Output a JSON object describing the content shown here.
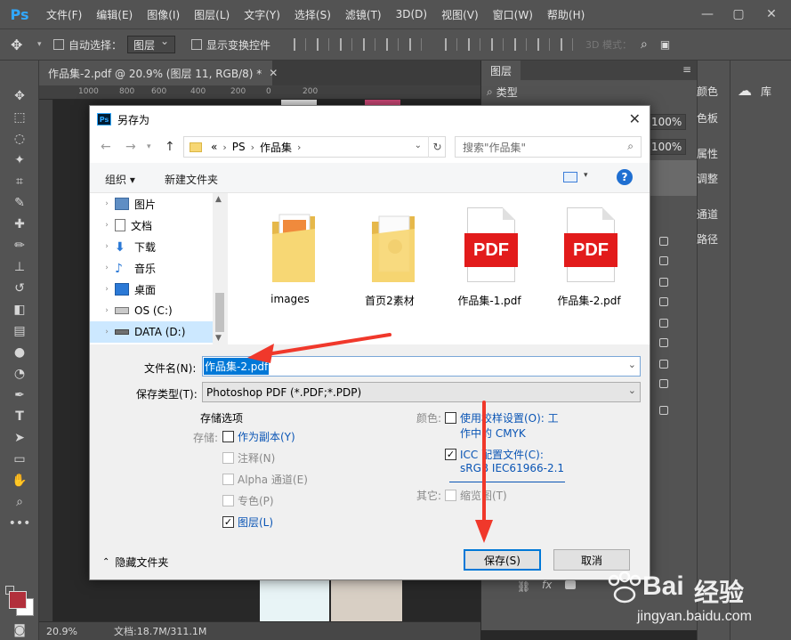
{
  "menubar": {
    "logo": "Ps",
    "items": [
      "文件(F)",
      "编辑(E)",
      "图像(I)",
      "图层(L)",
      "文字(Y)",
      "选择(S)",
      "滤镜(T)",
      "3D(D)",
      "视图(V)",
      "窗口(W)",
      "帮助(H)"
    ]
  },
  "optionsbar": {
    "auto_select_label": "自动选择：",
    "auto_select_value": "图层",
    "show_transform_label": "显示变换控件",
    "mode_3d": "3D 模式："
  },
  "document": {
    "tab_title": "作品集-2.pdf @ 20.9% (图层 11, RGB/8) *",
    "ruler_ticks": [
      "1000",
      "800",
      "600",
      "400",
      "200",
      "0",
      "200"
    ],
    "zoom": "20.9%",
    "doc_size": "文档:18.7M/311.1M"
  },
  "layers_panel": {
    "tab": "图层",
    "kind_label": "类型",
    "opacity": "100%",
    "fill": "100%",
    "footer_icons": [
      "link-icon",
      "fx-icon",
      "mask-icon"
    ]
  },
  "side_panels": {
    "labels": [
      "颜色",
      "色板",
      "属性",
      "调整",
      "通道",
      "路径"
    ],
    "library": "库"
  },
  "dialog": {
    "title": "另存为",
    "breadcrumb": [
      "«",
      "PS",
      "作品集"
    ],
    "search_placeholder": "搜索\"作品集\"",
    "organize": "组织 ▾",
    "new_folder": "新建文件夹",
    "nav_items": [
      {
        "label": "图片",
        "icon": "pictures-icon"
      },
      {
        "label": "文档",
        "icon": "documents-icon"
      },
      {
        "label": "下载",
        "icon": "downloads-icon"
      },
      {
        "label": "音乐",
        "icon": "music-icon"
      },
      {
        "label": "桌面",
        "icon": "desktop-icon"
      },
      {
        "label": "OS (C:)",
        "icon": "drive-icon"
      },
      {
        "label": "DATA (D:)",
        "icon": "drive-icon"
      }
    ],
    "files": [
      {
        "name": "images",
        "kind": "folder"
      },
      {
        "name": "首页2素材",
        "kind": "folder"
      },
      {
        "name": "作品集-1.pdf",
        "kind": "pdf"
      },
      {
        "name": "作品集-2.pdf",
        "kind": "pdf"
      }
    ],
    "pdf_badge": "PDF",
    "filename_label": "文件名(N):",
    "filename_value": "作品集-2.pdf",
    "filetype_label": "保存类型(T):",
    "filetype_value": "Photoshop PDF (*.PDF;*.PDP)",
    "save_options_title": "存储选项",
    "storage_label": "存储:",
    "opt_copy": "作为副本(Y)",
    "opt_notes": "注释(N)",
    "opt_alpha": "Alpha 通道(E)",
    "opt_spot": "专色(P)",
    "opt_layers": "图层(L)",
    "color_label": "颜色:",
    "opt_proof_line1": "使用校样设置(O):  工",
    "opt_proof_line2": "作中的 CMYK",
    "opt_icc_line1": "ICC 配置文件(C):",
    "opt_icc_line2": "sRGB IEC61966-2.1",
    "other_label": "其它:",
    "opt_thumb": "缩览图(T)",
    "hide_folders": "隐藏文件夹",
    "save_btn": "保存(S)",
    "cancel_btn": "取消"
  },
  "watermark": {
    "brand": "Bai",
    "brand2": "经验",
    "url": "jingyan.baidu.com"
  },
  "colors": {
    "accent": "#0078d7",
    "annotation": "#f0382b",
    "pdf_red": "#e21b1b"
  }
}
